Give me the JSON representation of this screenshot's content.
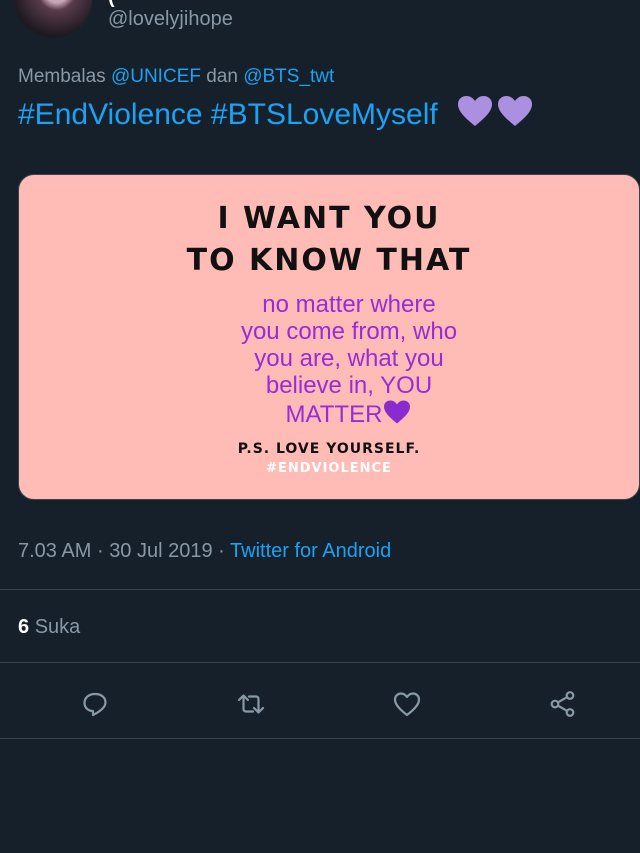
{
  "header": {
    "display_name": "(",
    "handle": "@lovelyjihope"
  },
  "reply": {
    "prefix": "Membalas",
    "mention_1": "@UNICEF",
    "conjunction": "dan",
    "mention_2": "@BTS_twt"
  },
  "tweet": {
    "text": "#EndViolence #BTSLoveMyself",
    "emoji": "purple-heart x2"
  },
  "media": {
    "headline_1": "I WANT YOU",
    "headline_2": "TO KNOW THAT",
    "body_lines": [
      "no matter where",
      "you come from, who",
      "you are, what you",
      "believe in, YOU",
      "MATTER"
    ],
    "ps": "P.S. LOVE YOURSELF.",
    "tag": "#ENDVIOLENCE",
    "bg_color": "#ffbcb6",
    "text_color": "#9a2bd6"
  },
  "meta": {
    "time": "7.03 AM",
    "separator": "·",
    "date": "30 Jul 2019",
    "source": "Twitter for Android"
  },
  "stats": {
    "likes_count": "6",
    "likes_label": "Suka"
  },
  "actions": [
    "reply-icon",
    "retweet-icon",
    "like-icon",
    "share-icon"
  ],
  "colors": {
    "background": "#15202b",
    "accent": "#1da1f2",
    "muted": "#8899a6",
    "divider": "#38444d",
    "heart": "#ab8fe0"
  }
}
